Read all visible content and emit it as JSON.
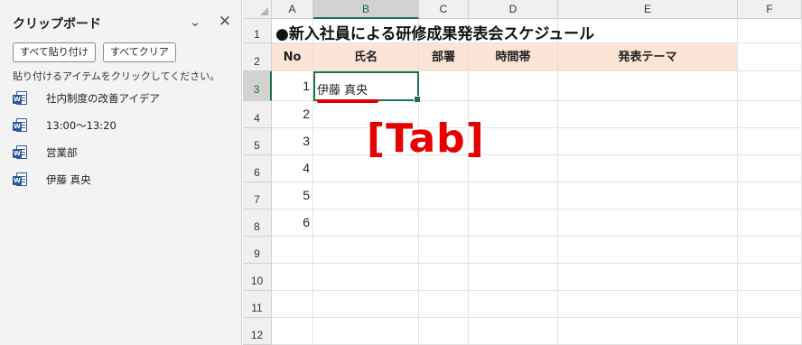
{
  "pane": {
    "title": "クリップボード",
    "paste_all": "すべて貼り付け",
    "clear_all": "すべてクリア",
    "hint": "貼り付けるアイテムをクリックしてください。",
    "items": [
      {
        "label": "社内制度の改善アイデア",
        "icon": "word-doc-icon"
      },
      {
        "label": "13:00～13:20",
        "icon": "word-doc-icon"
      },
      {
        "label": "営業部",
        "icon": "word-doc-icon"
      },
      {
        "label": "伊藤 真央",
        "icon": "word-doc-icon"
      }
    ]
  },
  "sheet": {
    "columns": [
      "A",
      "B",
      "C",
      "D",
      "E",
      "F"
    ],
    "rows": [
      "1",
      "2",
      "3",
      "4",
      "5",
      "6",
      "7",
      "8",
      "9",
      "10",
      "11",
      "12"
    ],
    "title": "●新入社員による研修成果発表会スケジュール",
    "headers": [
      "No",
      "氏名",
      "部署",
      "時間帯",
      "発表テーマ"
    ],
    "numbers": [
      "1",
      "2",
      "3",
      "4",
      "5",
      "6"
    ],
    "active_value": "伊藤 真央",
    "selected_column": "B",
    "selected_row": "3"
  },
  "annotation": {
    "key_label": "[Tab]",
    "color": "#e60000"
  },
  "colors": {
    "accent": "#217346",
    "header_fill": "#fce4d6",
    "word_blue": "#2b579a"
  }
}
